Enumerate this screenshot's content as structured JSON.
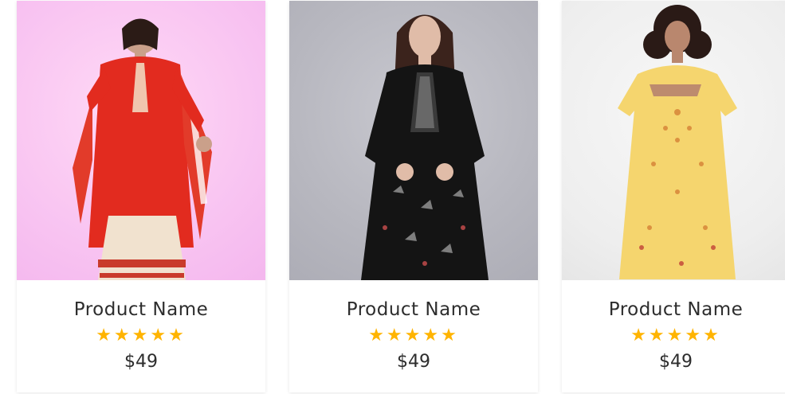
{
  "products": [
    {
      "name": "Product Name",
      "rating_stars": 5,
      "stars": "★★★★★",
      "price": "$49",
      "image_icon": "red-kurta-photo"
    },
    {
      "name": "Product Name",
      "rating_stars": 5,
      "stars": "★★★★★",
      "price": "$49",
      "image_icon": "black-kurta-photo"
    },
    {
      "name": "Product Name",
      "rating_stars": 5,
      "stars": "★★★★★",
      "price": "$49",
      "image_icon": "yellow-kurta-photo"
    }
  ],
  "colors": {
    "star": "#ffb400",
    "text": "#2d2d2d"
  }
}
